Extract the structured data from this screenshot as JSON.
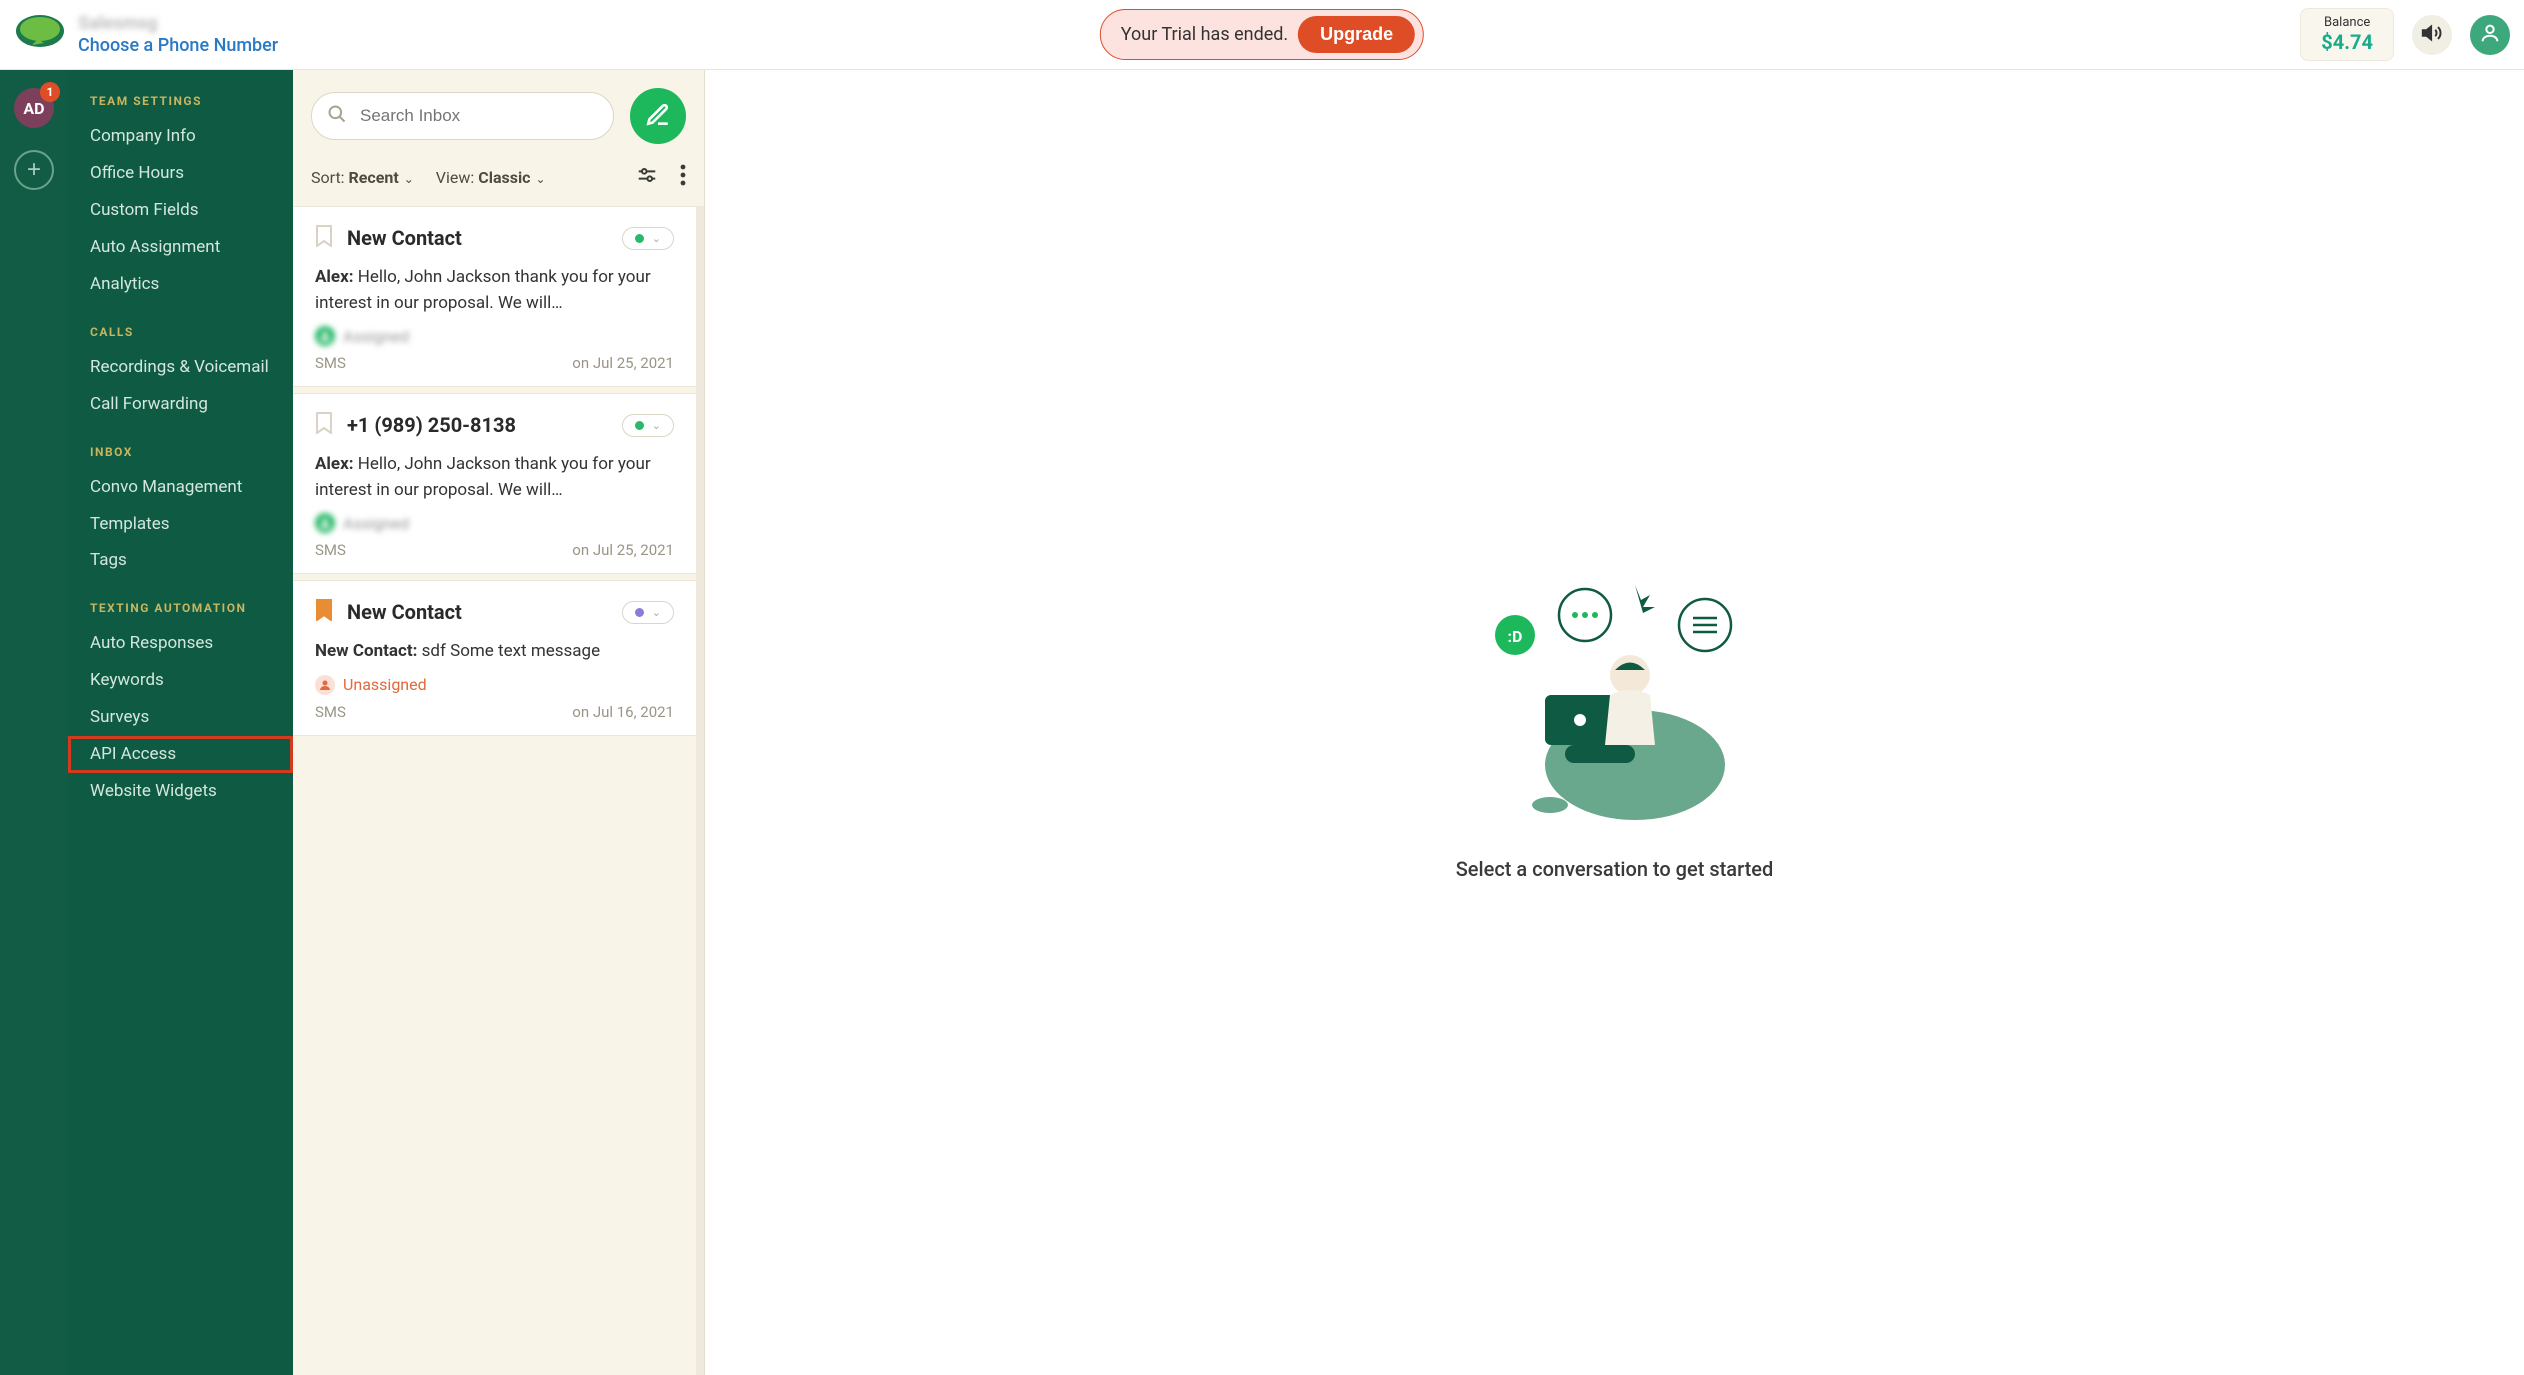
{
  "header": {
    "brand_name": "Salesmsg",
    "phone_link": "Choose a Phone Number",
    "trial_text": "Your Trial has ended.",
    "upgrade_label": "Upgrade",
    "balance_label": "Balance",
    "balance_value": "$4.74"
  },
  "rail": {
    "avatar_initials": "AD",
    "avatar_badge": "1"
  },
  "sidebar": {
    "sections": [
      {
        "header": "TEAM SETTINGS",
        "items": [
          {
            "label": "Company Info"
          },
          {
            "label": "Office Hours"
          },
          {
            "label": "Custom Fields"
          },
          {
            "label": "Auto Assignment"
          },
          {
            "label": "Analytics"
          }
        ]
      },
      {
        "header": "CALLS",
        "items": [
          {
            "label": "Recordings & Voicemail"
          },
          {
            "label": "Call Forwarding"
          }
        ]
      },
      {
        "header": "INBOX",
        "items": [
          {
            "label": "Convo Management"
          },
          {
            "label": "Templates"
          },
          {
            "label": "Tags"
          }
        ]
      },
      {
        "header": "TEXTING AUTOMATION",
        "items": [
          {
            "label": "Auto Responses"
          },
          {
            "label": "Keywords"
          },
          {
            "label": "Surveys"
          },
          {
            "label": "API Access",
            "highlighted": true
          },
          {
            "label": "Website Widgets"
          }
        ]
      }
    ]
  },
  "inbox": {
    "search_placeholder": "Search Inbox",
    "sort_label": "Sort: ",
    "sort_value": "Recent",
    "view_label": "View: ",
    "view_value": "Classic",
    "conversations": [
      {
        "title": "New Contact",
        "bookmarked": false,
        "status": "green",
        "preview_author": "Alex:",
        "preview_text": "Hello, John Jackson thank you for your interest in our proposal. We will…",
        "assignee": "Assigned",
        "assignee_blurred": true,
        "channel": "SMS",
        "date": "on Jul 25, 2021"
      },
      {
        "title": "+1 (989) 250-8138",
        "bookmarked": false,
        "status": "green",
        "preview_author": "Alex:",
        "preview_text": "Hello, John Jackson thank you for your interest in our proposal. We will…",
        "assignee": "Assigned",
        "assignee_blurred": true,
        "channel": "SMS",
        "date": "on Jul 25, 2021"
      },
      {
        "title": "New Contact",
        "bookmarked": true,
        "status": "purple",
        "preview_author": "New Contact:",
        "preview_text": "sdf Some text message",
        "assignee": "Unassigned",
        "assignee_blurred": false,
        "channel": "SMS",
        "date": "on Jul 16, 2021"
      }
    ]
  },
  "detail": {
    "empty_message": "Select a conversation to get started"
  }
}
